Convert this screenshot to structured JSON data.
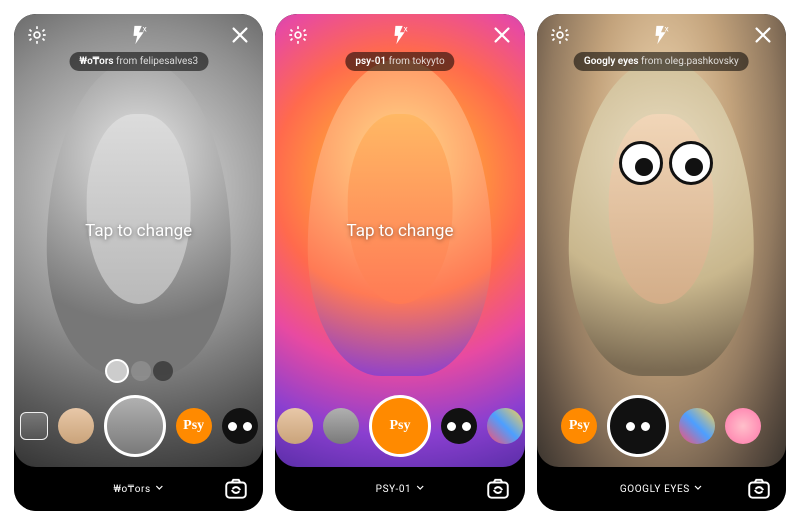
{
  "screens": [
    {
      "filter": {
        "name": "₩o₸ors",
        "author": "felipesalves3",
        "from_word": "from"
      },
      "hint": "Tap to change",
      "bottom_label": "₩o₸ors",
      "carousel": [
        {
          "kind": "gallery",
          "selected": false
        },
        {
          "kind": "face1",
          "selected": false
        },
        {
          "kind": "face2",
          "selected": true
        },
        {
          "kind": "psy",
          "selected": false,
          "label": "Psy"
        },
        {
          "kind": "eyes",
          "selected": false
        }
      ],
      "show_intensity_dots": true,
      "show_hint": true,
      "overlay": "bw"
    },
    {
      "filter": {
        "name": "psy-01",
        "author": "tokyyto",
        "from_word": "from"
      },
      "hint": "Tap to change",
      "bottom_label": "PSY-01",
      "carousel": [
        {
          "kind": "face1",
          "selected": false
        },
        {
          "kind": "face2",
          "selected": false
        },
        {
          "kind": "psy",
          "selected": true,
          "label": "Psy"
        },
        {
          "kind": "eyes",
          "selected": false
        },
        {
          "kind": "colorful",
          "selected": false
        }
      ],
      "show_intensity_dots": false,
      "show_hint": true,
      "overlay": "duo"
    },
    {
      "filter": {
        "name": "Googly eyes",
        "author": "oleg.pashkovsky",
        "from_word": "from"
      },
      "hint": "",
      "bottom_label": "GOOGLY EYES",
      "carousel": [
        {
          "kind": "psy",
          "selected": false,
          "label": "Psy"
        },
        {
          "kind": "eyes",
          "selected": true
        },
        {
          "kind": "colorful",
          "selected": false
        },
        {
          "kind": "pinky",
          "selected": false
        }
      ],
      "show_intensity_dots": false,
      "show_hint": false,
      "overlay": "nat",
      "googly": true
    }
  ]
}
